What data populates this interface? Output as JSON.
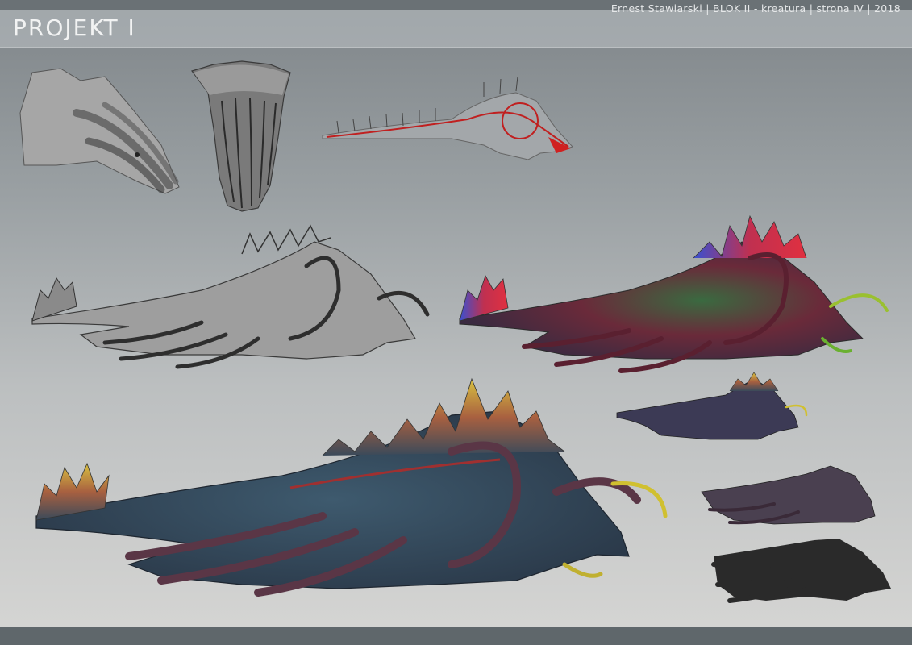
{
  "header": {
    "title": "PROJEKT I"
  },
  "footer": {
    "credits": "Ernest Stawiarski | BLOK II - kreatura | strona IV | 2018"
  },
  "colors": {
    "background_top": "#7f8589",
    "background_bottom": "#d6d6d4",
    "header_bar": "#6a7175",
    "footer_bar": "#5f676b",
    "creature_body": "#3c5062",
    "tentacle": "#5a3646",
    "fin_accent": "#c8b040",
    "sketch_gray": "#8a8a8a"
  },
  "artworks": [
    {
      "name": "head-study-side",
      "style": "grayscale sketch"
    },
    {
      "name": "head-study-front",
      "style": "grayscale sketch"
    },
    {
      "name": "skeleton-study",
      "style": "red line sketch"
    },
    {
      "name": "creature-sketch",
      "style": "grayscale sketch"
    },
    {
      "name": "creature-color-variant",
      "style": "multicolor"
    },
    {
      "name": "creature-final",
      "style": "color"
    },
    {
      "name": "creature-small-color",
      "style": "color thumbnail"
    },
    {
      "name": "creature-small-dark",
      "style": "value thumbnail"
    },
    {
      "name": "creature-silhouette",
      "style": "silhouette"
    }
  ]
}
